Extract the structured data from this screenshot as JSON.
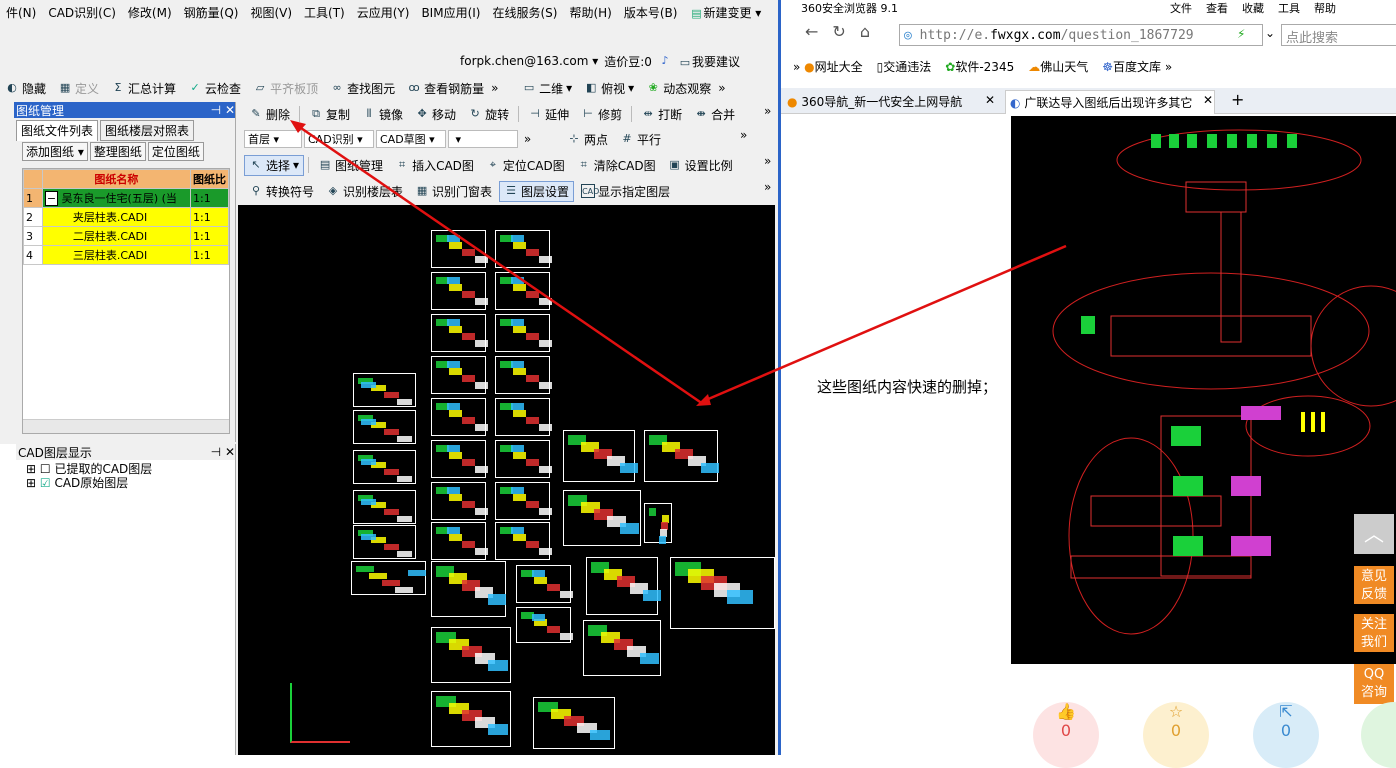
{
  "app": {
    "menus": [
      "件(N)",
      "CAD识别(C)",
      "修改(M)",
      "钢筋量(Q)",
      "视图(V)",
      "工具(T)",
      "云应用(Y)",
      "BIM应用(I)",
      "在线服务(S)",
      "帮助(H)",
      "版本号(B)",
      "新建变更 ▾"
    ],
    "user": {
      "account": "forpk.chen@163.com",
      "cost_label": "造价豆:0",
      "suggest": "我要建议"
    },
    "toolbar1": [
      "隐藏",
      "定义",
      "汇总计算",
      "云检查",
      "平齐板顶",
      "查找图元",
      "查看钢筋量"
    ],
    "view": {
      "mode": "二维",
      "angle": "俯视",
      "dynamic": "动态观察"
    },
    "toolbar2": [
      "删除",
      "复制",
      "镜像",
      "移动",
      "旋转",
      "延伸",
      "修剪",
      "打断",
      "合并"
    ],
    "combos": {
      "floor": "首层",
      "cad_id": "CAD识别",
      "cad_sketch": "CAD草图"
    },
    "toolbar3_right": [
      "两点",
      "平行"
    ],
    "toolbar4": [
      "选择",
      "图纸管理",
      "插入CAD图",
      "定位CAD图",
      "清除CAD图",
      "设置比例"
    ],
    "toolbar5": [
      "转换符号",
      "识别楼层表",
      "识别门窗表",
      "图层设置",
      "显示指定图层"
    ],
    "drawing_panel": {
      "title": "图纸管理",
      "tabs": [
        "图纸文件列表",
        "图纸楼层对照表"
      ],
      "buttons": [
        "添加图纸",
        "整理图纸",
        "定位图纸"
      ],
      "headers": [
        "图纸名称",
        "图纸比"
      ],
      "rows": [
        {
          "n": "1",
          "name": "吴东良一住宅(五层) (当",
          "scale": "1:1"
        },
        {
          "n": "2",
          "name": "夹层柱表.CADI",
          "scale": "1:1"
        },
        {
          "n": "3",
          "name": "二层柱表.CADI",
          "scale": "1:1"
        },
        {
          "n": "4",
          "name": "三层柱表.CADI",
          "scale": "1:1"
        }
      ]
    },
    "layer_panel": {
      "title": "CAD图层显示",
      "items": [
        "已提取的CAD图层",
        "CAD原始图层"
      ]
    }
  },
  "browser": {
    "title": "360安全浏览器 9.1",
    "menus": [
      "文件",
      "查看",
      "收藏",
      "工具",
      "帮助"
    ],
    "url_prefix": "http://e.",
    "url_domain": "fwxgx.com",
    "url_path": "/question_1867729",
    "search_placeholder": "点此搜索",
    "bookmarks": [
      "网址大全",
      "交通违法",
      "软件-2345",
      "佛山天气",
      "百度文库"
    ],
    "tabs": [
      "360导航_新一代安全上网导航",
      "广联达导入图纸后出现许多其它"
    ],
    "note": "这些图纸内容快速的删掉；",
    "side": [
      "意见\n反馈",
      "关注\n我们",
      "QQ\n咨询"
    ],
    "counts": [
      "0",
      "0",
      "0"
    ]
  },
  "colors": {
    "accent": "#2b64c8",
    "arrow": "#e01010",
    "yellow": "#ffff00",
    "orange": "#f08a24"
  }
}
